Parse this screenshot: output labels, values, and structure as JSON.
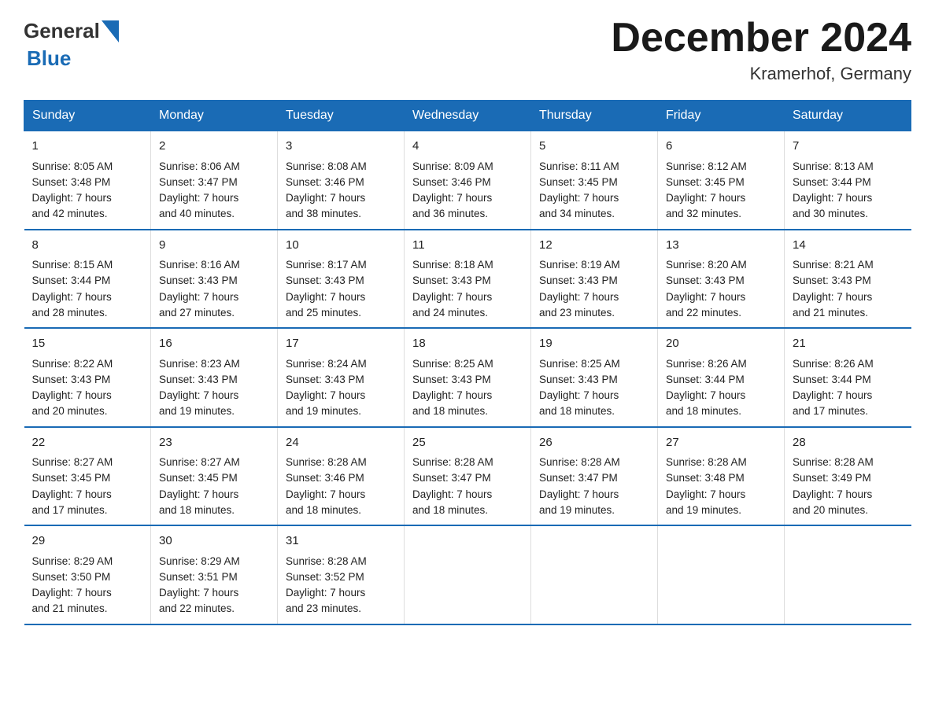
{
  "header": {
    "logo_general": "General",
    "logo_blue": "Blue",
    "main_title": "December 2024",
    "subtitle": "Kramerhof, Germany"
  },
  "days_of_week": [
    "Sunday",
    "Monday",
    "Tuesday",
    "Wednesday",
    "Thursday",
    "Friday",
    "Saturday"
  ],
  "weeks": [
    [
      {
        "day": "1",
        "sunrise": "8:05 AM",
        "sunset": "3:48 PM",
        "daylight": "7 hours and 42 minutes."
      },
      {
        "day": "2",
        "sunrise": "8:06 AM",
        "sunset": "3:47 PM",
        "daylight": "7 hours and 40 minutes."
      },
      {
        "day": "3",
        "sunrise": "8:08 AM",
        "sunset": "3:46 PM",
        "daylight": "7 hours and 38 minutes."
      },
      {
        "day": "4",
        "sunrise": "8:09 AM",
        "sunset": "3:46 PM",
        "daylight": "7 hours and 36 minutes."
      },
      {
        "day": "5",
        "sunrise": "8:11 AM",
        "sunset": "3:45 PM",
        "daylight": "7 hours and 34 minutes."
      },
      {
        "day": "6",
        "sunrise": "8:12 AM",
        "sunset": "3:45 PM",
        "daylight": "7 hours and 32 minutes."
      },
      {
        "day": "7",
        "sunrise": "8:13 AM",
        "sunset": "3:44 PM",
        "daylight": "7 hours and 30 minutes."
      }
    ],
    [
      {
        "day": "8",
        "sunrise": "8:15 AM",
        "sunset": "3:44 PM",
        "daylight": "7 hours and 28 minutes."
      },
      {
        "day": "9",
        "sunrise": "8:16 AM",
        "sunset": "3:43 PM",
        "daylight": "7 hours and 27 minutes."
      },
      {
        "day": "10",
        "sunrise": "8:17 AM",
        "sunset": "3:43 PM",
        "daylight": "7 hours and 25 minutes."
      },
      {
        "day": "11",
        "sunrise": "8:18 AM",
        "sunset": "3:43 PM",
        "daylight": "7 hours and 24 minutes."
      },
      {
        "day": "12",
        "sunrise": "8:19 AM",
        "sunset": "3:43 PM",
        "daylight": "7 hours and 23 minutes."
      },
      {
        "day": "13",
        "sunrise": "8:20 AM",
        "sunset": "3:43 PM",
        "daylight": "7 hours and 22 minutes."
      },
      {
        "day": "14",
        "sunrise": "8:21 AM",
        "sunset": "3:43 PM",
        "daylight": "7 hours and 21 minutes."
      }
    ],
    [
      {
        "day": "15",
        "sunrise": "8:22 AM",
        "sunset": "3:43 PM",
        "daylight": "7 hours and 20 minutes."
      },
      {
        "day": "16",
        "sunrise": "8:23 AM",
        "sunset": "3:43 PM",
        "daylight": "7 hours and 19 minutes."
      },
      {
        "day": "17",
        "sunrise": "8:24 AM",
        "sunset": "3:43 PM",
        "daylight": "7 hours and 19 minutes."
      },
      {
        "day": "18",
        "sunrise": "8:25 AM",
        "sunset": "3:43 PM",
        "daylight": "7 hours and 18 minutes."
      },
      {
        "day": "19",
        "sunrise": "8:25 AM",
        "sunset": "3:43 PM",
        "daylight": "7 hours and 18 minutes."
      },
      {
        "day": "20",
        "sunrise": "8:26 AM",
        "sunset": "3:44 PM",
        "daylight": "7 hours and 18 minutes."
      },
      {
        "day": "21",
        "sunrise": "8:26 AM",
        "sunset": "3:44 PM",
        "daylight": "7 hours and 17 minutes."
      }
    ],
    [
      {
        "day": "22",
        "sunrise": "8:27 AM",
        "sunset": "3:45 PM",
        "daylight": "7 hours and 17 minutes."
      },
      {
        "day": "23",
        "sunrise": "8:27 AM",
        "sunset": "3:45 PM",
        "daylight": "7 hours and 18 minutes."
      },
      {
        "day": "24",
        "sunrise": "8:28 AM",
        "sunset": "3:46 PM",
        "daylight": "7 hours and 18 minutes."
      },
      {
        "day": "25",
        "sunrise": "8:28 AM",
        "sunset": "3:47 PM",
        "daylight": "7 hours and 18 minutes."
      },
      {
        "day": "26",
        "sunrise": "8:28 AM",
        "sunset": "3:47 PM",
        "daylight": "7 hours and 19 minutes."
      },
      {
        "day": "27",
        "sunrise": "8:28 AM",
        "sunset": "3:48 PM",
        "daylight": "7 hours and 19 minutes."
      },
      {
        "day": "28",
        "sunrise": "8:28 AM",
        "sunset": "3:49 PM",
        "daylight": "7 hours and 20 minutes."
      }
    ],
    [
      {
        "day": "29",
        "sunrise": "8:29 AM",
        "sunset": "3:50 PM",
        "daylight": "7 hours and 21 minutes."
      },
      {
        "day": "30",
        "sunrise": "8:29 AM",
        "sunset": "3:51 PM",
        "daylight": "7 hours and 22 minutes."
      },
      {
        "day": "31",
        "sunrise": "8:28 AM",
        "sunset": "3:52 PM",
        "daylight": "7 hours and 23 minutes."
      },
      null,
      null,
      null,
      null
    ]
  ]
}
